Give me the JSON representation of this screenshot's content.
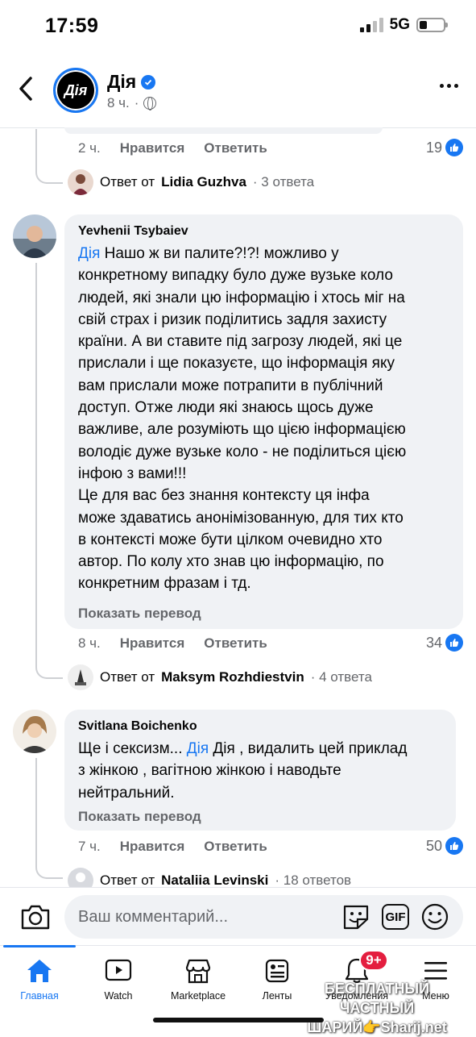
{
  "status_bar": {
    "time": "17:59",
    "network": "5G"
  },
  "header": {
    "page_name": "Дія",
    "logo_text": "Дія",
    "time_ago": "8 ч.",
    "separator": "·"
  },
  "comments": [
    {
      "id": "prev",
      "time": "2 ч.",
      "like_label": "Нравится",
      "reply_label": "Ответить",
      "likes": "19",
      "reply_prefix": "Ответ от",
      "reply_author": "Lidia Guzhva",
      "reply_count": "· 3 ответа"
    },
    {
      "id": "yevhenii",
      "author": "Yevhenii Tsybaiev",
      "mention": "Дія",
      "lines": [
        " Нашо ж ви палите?!?! можливо у",
        "конкретному випадку було дуже вузьке коло",
        "людей, які знали цю інформацію і хтось міг на",
        "свій страх і ризик поділитись задля захисту",
        "країни.  А ви ставите під загрозу людей, які це",
        "прислали і ще показуєте, що інформація яку",
        "вам прислали може потрапити в публічний",
        "доступ. Отже люди які знаюсь щось дуже",
        "важливе, але розуміють що цією інформацією",
        "володіє дуже вузьке коло - не поділиться цією",
        "інфою з вами!!!",
        "Це для вас без знання контексту ця інфа",
        "може здаватись анонімізованную, для тих кто",
        "в контексті може бути цілком очевидно хто",
        "автор. По колу хто знав цю інформацію, по",
        "конкретним фразам і тд."
      ],
      "translate": "Показать перевод",
      "time": "8 ч.",
      "like_label": "Нравится",
      "reply_label": "Ответить",
      "likes": "34",
      "reply_prefix": "Ответ от",
      "reply_author": "Maksym Rozhdiestvin",
      "reply_count": "· 4 ответа"
    },
    {
      "id": "svitlana",
      "author": "Svitlana Boichenko",
      "line1_prefix": "Ще і сексизм... ",
      "mention": "Дія",
      "line1_suffix": " Дія , видалить цей приклад",
      "lines": [
        "з жінкою , вагітною жінкою і наводьте",
        "нейтральний."
      ],
      "translate": "Показать перевод",
      "time": "7 ч.",
      "like_label": "Нравится",
      "reply_label": "Ответить",
      "likes": "50",
      "reply_prefix": "Ответ от",
      "reply_author": "Nataliia Levinski",
      "reply_count": "· 18 ответов"
    }
  ],
  "composer": {
    "placeholder": "Ваш комментарий...",
    "gif_label": "GIF"
  },
  "tabs": [
    {
      "label": "Главная",
      "icon": "home-icon"
    },
    {
      "label": "Watch",
      "icon": "watch-icon"
    },
    {
      "label": "Marketplace",
      "icon": "marketplace-icon"
    },
    {
      "label": "Ленты",
      "icon": "feeds-icon"
    },
    {
      "label": "Уведомления",
      "icon": "bell-icon"
    },
    {
      "label": "Меню",
      "icon": "menu-icon"
    }
  ],
  "notifications_badge": "9+",
  "watermark": {
    "line1": "БЕСПЛАТНЫЙ ЧАСТНЫЙ",
    "line2": "ШАРИЙ👉Sharij.net"
  },
  "colors": {
    "accent": "#1877f2",
    "bubble": "#f0f2f5",
    "secondary_text": "#65676b",
    "badge": "#e41e3f"
  }
}
